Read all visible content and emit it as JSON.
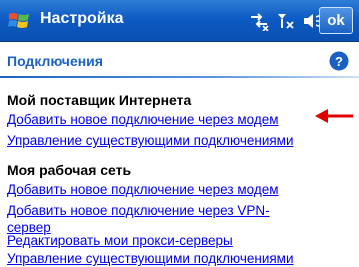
{
  "titlebar": {
    "title": "Настройка",
    "ok_label": "ok"
  },
  "header": {
    "section_title": "Подключения"
  },
  "groups": [
    {
      "heading": "Мой поставщик Интернета",
      "links": [
        "Добавить новое подключение через модем",
        "Управление существующими подключениями"
      ]
    },
    {
      "heading": "Моя рабочая сеть",
      "links": [
        "Добавить новое подключение через модем",
        "Добавить новое подключение через VPN-сервер",
        "Редактировать мои прокси-серверы",
        "Управление существующими подключениями"
      ]
    }
  ],
  "colors": {
    "titlebar": "#0d5bc4",
    "accent": "#1a63c5",
    "link": "#0000ee",
    "arrow": "#e00000"
  },
  "icons": [
    "windows-start-icon",
    "network-connection-icon",
    "signal-off-icon",
    "volume-icon",
    "help-icon",
    "red-arrow-icon"
  ]
}
